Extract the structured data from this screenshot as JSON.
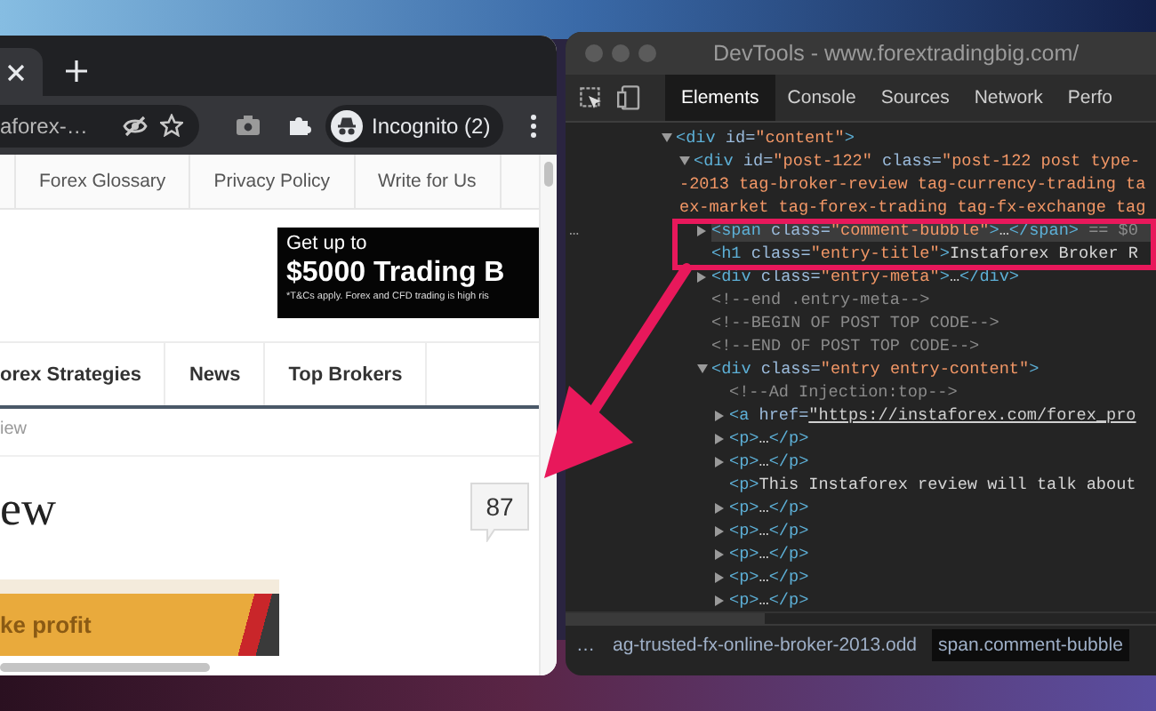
{
  "browser": {
    "address": {
      "value": "aforex-…"
    },
    "profile": {
      "label": "Incognito (2)"
    },
    "page": {
      "top_nav": [
        {
          "label": "Forex Glossary"
        },
        {
          "label": "Privacy Policy"
        },
        {
          "label": "Write for Us"
        }
      ],
      "ad": {
        "lead": "Get up to",
        "headline": "$5000 Trading B",
        "disclaimer": "*T&Cs apply. Forex and CFD trading is high ris"
      },
      "main_nav": [
        {
          "label": "orex Strategies"
        },
        {
          "label": "News"
        },
        {
          "label": "Top Brokers"
        }
      ],
      "breadcrumb": "iew",
      "title": "ew",
      "comment_count": "87",
      "banner": "ke profit"
    }
  },
  "devtools": {
    "title": "DevTools - www.forextradingbig.com/",
    "tabs": [
      {
        "label": "Elements",
        "selected": true
      },
      {
        "label": "Console",
        "selected": false
      },
      {
        "label": "Sources",
        "selected": false
      },
      {
        "label": "Network",
        "selected": false
      },
      {
        "label": "Perfo",
        "selected": false
      }
    ],
    "dom": [
      {
        "expanded": true,
        "selected": false,
        "lines": [
          [
            {
              "kind": "tag",
              "text": "<div "
            },
            {
              "kind": "attr",
              "text": "id="
            },
            {
              "kind": "value",
              "text": "\"content\""
            },
            {
              "kind": "tag",
              "text": ">"
            }
          ]
        ],
        "children": [
          {
            "expanded": true,
            "selected": false,
            "lines": [
              [
                {
                  "kind": "tag",
                  "text": "<div "
                },
                {
                  "kind": "attr",
                  "text": "id="
                },
                {
                  "kind": "value",
                  "text": "\"post-122\" "
                },
                {
                  "kind": "attr",
                  "text": "class="
                },
                {
                  "kind": "value",
                  "text": "\"post-122 post type-"
                }
              ],
              [
                {
                  "kind": "value",
                  "text": "-2013 tag-broker-review tag-currency-trading ta"
                }
              ],
              [
                {
                  "kind": "value",
                  "text": "ex-market tag-forex-trading tag-fx-exchange tag"
                }
              ]
            ],
            "children": [
              {
                "expanded": false,
                "selected": true,
                "gutter": "…",
                "lines": [
                  [
                    {
                      "kind": "tag",
                      "text": "<span "
                    },
                    {
                      "kind": "attr",
                      "text": "class="
                    },
                    {
                      "kind": "value",
                      "text": "\"comment-bubble\""
                    },
                    {
                      "kind": "tag",
                      "text": ">"
                    },
                    {
                      "kind": "text",
                      "text": "…"
                    },
                    {
                      "kind": "tag",
                      "text": "</span>"
                    },
                    {
                      "kind": "note",
                      "text": " == $0"
                    }
                  ]
                ]
              },
              {
                "selected": false,
                "lines": [
                  [
                    {
                      "kind": "tag",
                      "text": "<h1 "
                    },
                    {
                      "kind": "attr",
                      "text": "class="
                    },
                    {
                      "kind": "value",
                      "text": "\"entry-title\""
                    },
                    {
                      "kind": "tag",
                      "text": ">"
                    },
                    {
                      "kind": "text",
                      "text": "Instaforex Broker R"
                    }
                  ]
                ]
              },
              {
                "expanded": false,
                "selected": false,
                "lines": [
                  [
                    {
                      "kind": "tag",
                      "text": "<div "
                    },
                    {
                      "kind": "attr",
                      "text": "class="
                    },
                    {
                      "kind": "value",
                      "text": "\"entry-meta\""
                    },
                    {
                      "kind": "tag",
                      "text": ">"
                    },
                    {
                      "kind": "text",
                      "text": "…"
                    },
                    {
                      "kind": "tag",
                      "text": "</div>"
                    }
                  ]
                ]
              },
              {
                "selected": false,
                "lines": [
                  [
                    {
                      "kind": "comment",
                      "text": "<!--end .entry-meta-->"
                    }
                  ]
                ]
              },
              {
                "selected": false,
                "lines": [
                  [
                    {
                      "kind": "comment",
                      "text": "<!--BEGIN OF POST TOP CODE-->"
                    }
                  ]
                ]
              },
              {
                "selected": false,
                "lines": [
                  [
                    {
                      "kind": "comment",
                      "text": "<!--END OF POST TOP CODE-->"
                    }
                  ]
                ]
              },
              {
                "expanded": true,
                "selected": false,
                "lines": [
                  [
                    {
                      "kind": "tag",
                      "text": "<div "
                    },
                    {
                      "kind": "attr",
                      "text": "class="
                    },
                    {
                      "kind": "value",
                      "text": "\"entry entry-content\""
                    },
                    {
                      "kind": "tag",
                      "text": ">"
                    }
                  ]
                ],
                "children": [
                  {
                    "selected": false,
                    "lines": [
                      [
                        {
                          "kind": "comment",
                          "text": "<!--Ad Injection:top-->"
                        }
                      ]
                    ]
                  },
                  {
                    "expanded": false,
                    "selected": false,
                    "lines": [
                      [
                        {
                          "kind": "tag",
                          "text": "<a "
                        },
                        {
                          "kind": "attr",
                          "text": "href="
                        },
                        {
                          "kind": "link",
                          "text": "\"https://instaforex.com/forex_pro"
                        }
                      ]
                    ]
                  },
                  {
                    "expanded": false,
                    "selected": false,
                    "lines": [
                      [
                        {
                          "kind": "tag",
                          "text": "<p>"
                        },
                        {
                          "kind": "text",
                          "text": "…"
                        },
                        {
                          "kind": "tag",
                          "text": "</p>"
                        }
                      ]
                    ]
                  },
                  {
                    "expanded": false,
                    "selected": false,
                    "lines": [
                      [
                        {
                          "kind": "tag",
                          "text": "<p>"
                        },
                        {
                          "kind": "text",
                          "text": "…"
                        },
                        {
                          "kind": "tag",
                          "text": "</p>"
                        }
                      ]
                    ]
                  },
                  {
                    "selected": false,
                    "lines": [
                      [
                        {
                          "kind": "tag",
                          "text": "<p>"
                        },
                        {
                          "kind": "text",
                          "text": "This Instaforex review will talk about"
                        }
                      ]
                    ]
                  },
                  {
                    "expanded": false,
                    "selected": false,
                    "lines": [
                      [
                        {
                          "kind": "tag",
                          "text": "<p>"
                        },
                        {
                          "kind": "text",
                          "text": "…"
                        },
                        {
                          "kind": "tag",
                          "text": "</p>"
                        }
                      ]
                    ]
                  },
                  {
                    "expanded": false,
                    "selected": false,
                    "lines": [
                      [
                        {
                          "kind": "tag",
                          "text": "<p>"
                        },
                        {
                          "kind": "text",
                          "text": "…"
                        },
                        {
                          "kind": "tag",
                          "text": "</p>"
                        }
                      ]
                    ]
                  },
                  {
                    "expanded": false,
                    "selected": false,
                    "lines": [
                      [
                        {
                          "kind": "tag",
                          "text": "<p>"
                        },
                        {
                          "kind": "text",
                          "text": "…"
                        },
                        {
                          "kind": "tag",
                          "text": "</p>"
                        }
                      ]
                    ]
                  },
                  {
                    "expanded": false,
                    "selected": false,
                    "lines": [
                      [
                        {
                          "kind": "tag",
                          "text": "<p>"
                        },
                        {
                          "kind": "text",
                          "text": "…"
                        },
                        {
                          "kind": "tag",
                          "text": "</p>"
                        }
                      ]
                    ]
                  },
                  {
                    "expanded": false,
                    "selected": false,
                    "lines": [
                      [
                        {
                          "kind": "tag",
                          "text": "<p>"
                        },
                        {
                          "kind": "text",
                          "text": "…"
                        },
                        {
                          "kind": "tag",
                          "text": "</p>"
                        }
                      ]
                    ]
                  }
                ]
              }
            ]
          }
        ]
      }
    ],
    "breadcrumbs": [
      {
        "label": "…",
        "selected": false
      },
      {
        "label": "ag-trusted-fx-online-broker-2013.odd",
        "selected": false
      },
      {
        "label": "span.comment-bubble",
        "selected": true
      }
    ]
  }
}
